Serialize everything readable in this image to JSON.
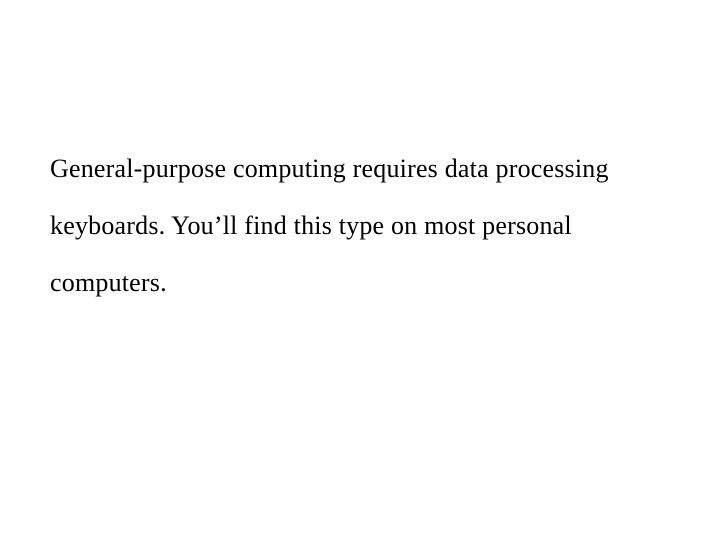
{
  "document": {
    "paragraph": "General-purpose computing requires data processing keyboards. You’ll find this type on most personal computers."
  }
}
